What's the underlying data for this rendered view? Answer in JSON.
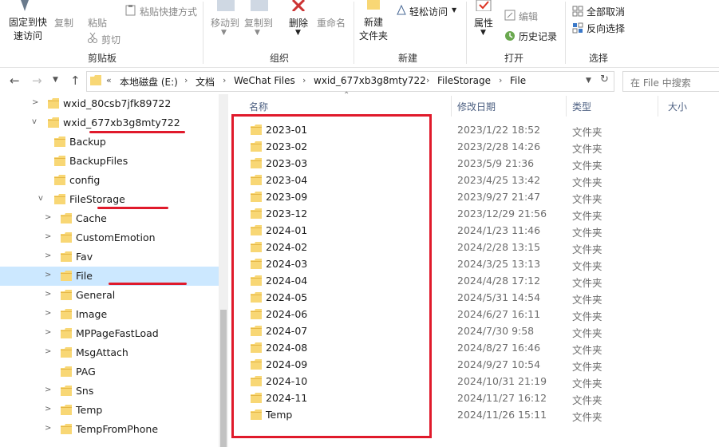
{
  "ribbon": {
    "pin_quick_access": "固定到快\n速访问",
    "copy": "复制",
    "paste": "粘贴",
    "paste_shortcut": "粘贴快捷方式",
    "cut": "剪切",
    "group_clipboard": "剪贴板",
    "move_to": "移动到",
    "copy_to": "复制到",
    "delete": "删除",
    "rename": "重命名",
    "group_organize": "组织",
    "new_folder": "新建\n文件夹",
    "easy_access": "轻松访问",
    "group_new": "新建",
    "properties": "属性",
    "edit": "编辑",
    "history": "历史记录",
    "group_open": "打开",
    "select_none": "全部取消",
    "invert_selection": "反向选择",
    "group_select": "选择"
  },
  "address": {
    "overflow": "«",
    "crumbs": [
      "本地磁盘 (E:)",
      "文档",
      "WeChat Files",
      "wxid_677xb3g8mty722",
      "FileStorage",
      "File"
    ],
    "search_placeholder": "在 File 中搜索"
  },
  "tree": [
    {
      "label": "wxid_80csb7jfk89722",
      "indent": 0,
      "expander": ">"
    },
    {
      "label": "wxid_677xb3g8mty722",
      "indent": 0,
      "expander": "v"
    },
    {
      "label": "Backup",
      "indent": 1,
      "expander": ""
    },
    {
      "label": "BackupFiles",
      "indent": 1,
      "expander": ""
    },
    {
      "label": "config",
      "indent": 1,
      "expander": ""
    },
    {
      "label": "FileStorage",
      "indent": 1,
      "expander": "v"
    },
    {
      "label": "Cache",
      "indent": 2,
      "expander": ">"
    },
    {
      "label": "CustomEmotion",
      "indent": 2,
      "expander": ">"
    },
    {
      "label": "Fav",
      "indent": 2,
      "expander": ">"
    },
    {
      "label": "File",
      "indent": 2,
      "expander": ">",
      "selected": true
    },
    {
      "label": "General",
      "indent": 2,
      "expander": ">"
    },
    {
      "label": "Image",
      "indent": 2,
      "expander": ">"
    },
    {
      "label": "MPPageFastLoad",
      "indent": 2,
      "expander": ">"
    },
    {
      "label": "MsgAttach",
      "indent": 2,
      "expander": ">"
    },
    {
      "label": "PAG",
      "indent": 2,
      "expander": ""
    },
    {
      "label": "Sns",
      "indent": 2,
      "expander": ">"
    },
    {
      "label": "Temp",
      "indent": 2,
      "expander": ">"
    },
    {
      "label": "TempFromPhone",
      "indent": 2,
      "expander": ">"
    }
  ],
  "columns": {
    "name": "名称",
    "modified": "修改日期",
    "type": "类型",
    "size": "大小"
  },
  "files": [
    {
      "name": "2023-01",
      "modified": "2023/1/22 18:52",
      "type": "文件夹"
    },
    {
      "name": "2023-02",
      "modified": "2023/2/28 14:26",
      "type": "文件夹"
    },
    {
      "name": "2023-03",
      "modified": "2023/5/9 21:36",
      "type": "文件夹"
    },
    {
      "name": "2023-04",
      "modified": "2023/4/25 13:42",
      "type": "文件夹"
    },
    {
      "name": "2023-09",
      "modified": "2023/9/27 21:47",
      "type": "文件夹"
    },
    {
      "name": "2023-12",
      "modified": "2023/12/29 21:56",
      "type": "文件夹"
    },
    {
      "name": "2024-01",
      "modified": "2024/1/23 11:46",
      "type": "文件夹"
    },
    {
      "name": "2024-02",
      "modified": "2024/2/28 13:15",
      "type": "文件夹"
    },
    {
      "name": "2024-03",
      "modified": "2024/3/25 13:13",
      "type": "文件夹"
    },
    {
      "name": "2024-04",
      "modified": "2024/4/28 17:12",
      "type": "文件夹"
    },
    {
      "name": "2024-05",
      "modified": "2024/5/31 14:54",
      "type": "文件夹"
    },
    {
      "name": "2024-06",
      "modified": "2024/6/27 16:11",
      "type": "文件夹"
    },
    {
      "name": "2024-07",
      "modified": "2024/7/30 9:58",
      "type": "文件夹"
    },
    {
      "name": "2024-08",
      "modified": "2024/8/27 16:46",
      "type": "文件夹"
    },
    {
      "name": "2024-09",
      "modified": "2024/9/27 10:54",
      "type": "文件夹"
    },
    {
      "name": "2024-10",
      "modified": "2024/10/31 21:19",
      "type": "文件夹"
    },
    {
      "name": "2024-11",
      "modified": "2024/11/27 16:12",
      "type": "文件夹"
    },
    {
      "name": "Temp",
      "modified": "2024/11/26 15:11",
      "type": "文件夹"
    }
  ],
  "colors": {
    "folder": "#f8d775",
    "folder_dark": "#e6b745",
    "selection": "#cce8ff",
    "annotation": "#e01a2b"
  }
}
